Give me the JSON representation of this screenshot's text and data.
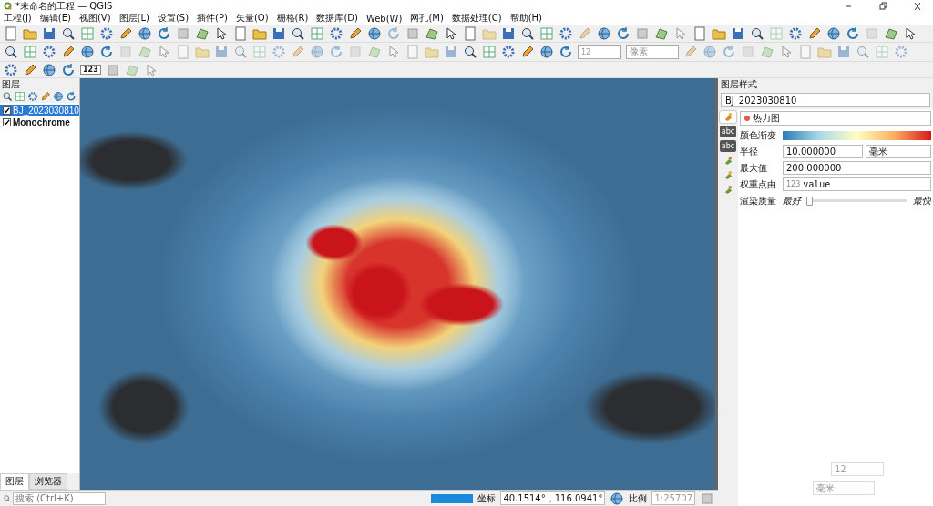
{
  "window": {
    "title": "*未命名的工程 — QGIS"
  },
  "menu": [
    {
      "label": "工程(J)"
    },
    {
      "label": "编辑(E)"
    },
    {
      "label": "视图(V)"
    },
    {
      "label": "图层(L)"
    },
    {
      "label": "设置(S)"
    },
    {
      "label": "插件(P)"
    },
    {
      "label": "矢量(O)"
    },
    {
      "label": "栅格(R)"
    },
    {
      "label": "数据库(D)"
    },
    {
      "label": "Web(W)"
    },
    {
      "label": "网孔(M)"
    },
    {
      "label": "数据处理(C)"
    },
    {
      "label": "帮助(H)"
    }
  ],
  "toolbar": {
    "size": "12",
    "unit": "像素",
    "label_tool": "123"
  },
  "layers_panel": {
    "title": "图层",
    "layers": [
      {
        "name": "BJ_2023030810",
        "checked": true,
        "selected": true
      },
      {
        "name": "Monochrome",
        "checked": true,
        "selected": false
      }
    ]
  },
  "bottom_tabs": [
    {
      "label": "图层",
      "selected": true
    },
    {
      "label": "浏览器",
      "selected": false
    }
  ],
  "search": {
    "placeholder": "搜索 (Ctrl+K)"
  },
  "status": {
    "progress": {
      "level": 1
    },
    "coord_label": "坐标",
    "coordinate": "40.1514°，116.0941°",
    "scale_label": "比例",
    "scale": "1:25707"
  },
  "style_panel": {
    "title": "图层样式",
    "layer": "BJ_2023030810",
    "renderer": "热力图",
    "ramp_label": "颜色渐变",
    "radius_label": "半径",
    "radius": "10.000000",
    "radius_unit": "毫米",
    "max_label": "最大值",
    "max": "200.000000",
    "weight_label": "权重点由",
    "weight_prefix": "123",
    "weight": "value",
    "quality_label": "渲染质量",
    "quality_min": "最好",
    "quality_max": "最快",
    "quality": {
      "level": 0
    }
  },
  "side_tabs": [
    {
      "kind": "icon",
      "selected": true
    },
    {
      "kind": "label",
      "label": "abc",
      "selected": false
    },
    {
      "kind": "label",
      "label": "abc",
      "selected": false
    },
    {
      "kind": "icon",
      "selected": false
    },
    {
      "kind": "icon",
      "selected": false
    },
    {
      "kind": "icon",
      "selected": false
    }
  ],
  "ghost": {
    "size": "12",
    "unit": "毫米"
  }
}
